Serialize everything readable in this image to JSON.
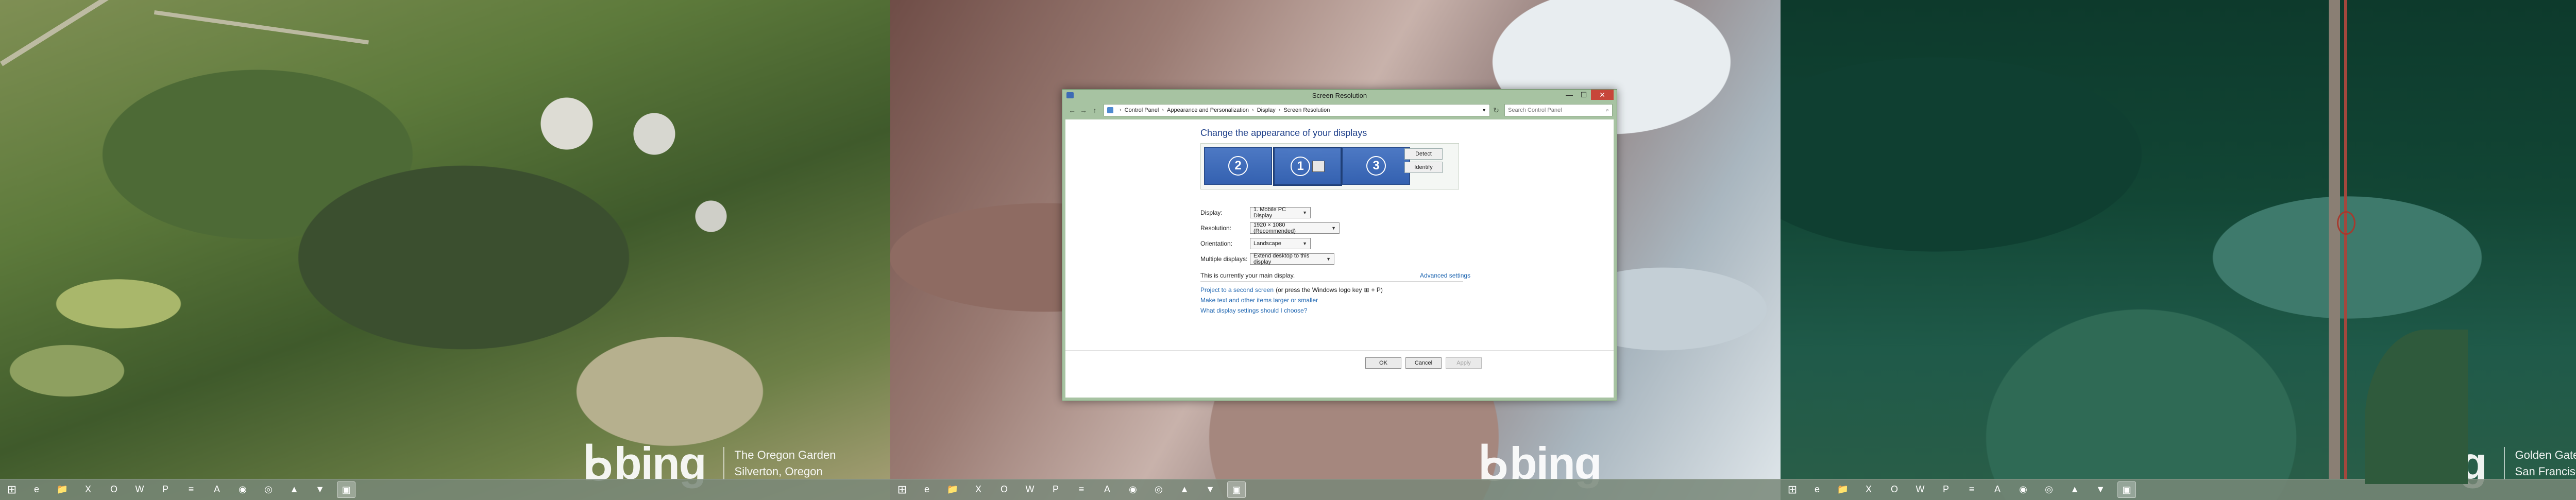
{
  "screens": [
    {
      "caption_lines": [
        "The Oregon Garden",
        "Silverton, Oregon"
      ]
    },
    {
      "caption_lines": [
        "",
        ""
      ]
    },
    {
      "caption_lines": [
        "Golden Gate Bridge",
        "San Francisco, California"
      ]
    }
  ],
  "bing_label": "bing",
  "taskbar": {
    "icons": [
      "ie-icon",
      "folder-icon",
      "excel-icon",
      "outlook-icon",
      "word-icon",
      "powerpoint-icon",
      "notepad-icon",
      "acrobat-icon",
      "viber-icon",
      "chrome-icon",
      "reader-icon",
      "vlc-icon",
      "display-icon"
    ],
    "glyphs": [
      "e",
      "📁",
      "X",
      "O",
      "W",
      "P",
      "≡",
      "A",
      "◉",
      "◎",
      "▲",
      "▼",
      "▣"
    ],
    "active_index": 12
  },
  "dialog": {
    "title": "Screen Resolution",
    "breadcrumb": [
      "Control Panel",
      "Appearance and Personalization",
      "Display",
      "Screen Resolution"
    ],
    "search_placeholder": "Search Control Panel",
    "heading": "Change the appearance of your displays",
    "monitors": [
      "2",
      "1",
      "3"
    ],
    "detect_label": "Detect",
    "identify_label": "Identify",
    "display_label": "Display:",
    "display_value": "1. Mobile PC Display",
    "resolution_label": "Resolution:",
    "resolution_value": "1920 × 1080 (Recommended)",
    "orientation_label": "Orientation:",
    "orientation_value": "Landscape",
    "multiple_label": "Multiple displays:",
    "multiple_value": "Extend desktop to this display",
    "main_display_text": "This is currently your main display.",
    "advanced_link": "Advanced settings",
    "project_link": "Project to a second screen",
    "project_suffix": "(or press the Windows logo key",
    "project_key": "+ P)",
    "text_size_link": "Make text and other items larger or smaller",
    "which_settings_link": "What display settings should I choose?",
    "ok_label": "OK",
    "cancel_label": "Cancel",
    "apply_label": "Apply"
  }
}
